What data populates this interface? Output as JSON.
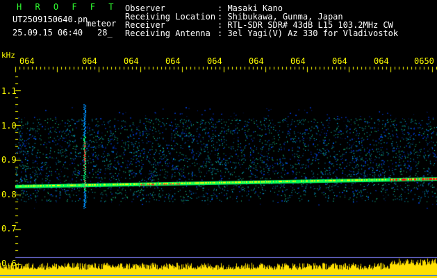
{
  "header": {
    "title": "H R O F F T",
    "filename": "UT2509150640.pn",
    "tag": "meteor",
    "datetime": "25.09.15 06:40",
    "count": "28_",
    "fields": [
      {
        "label": "Observer",
        "value": ": Masaki Kano"
      },
      {
        "label": "Receiving Location",
        "value": ": Shibukawa, Gunma, Japan"
      },
      {
        "label": "Receiver",
        "value": ": RTL-SDR SDR# 43dB L15 103.2MHz CW"
      },
      {
        "label": "Receiving Antenna",
        "value": ": 3el Yagi(V) Az 330 for Vladivostok"
      }
    ]
  },
  "axes": {
    "unit": "kHz",
    "time_ticks": [
      "064",
      "064",
      "064",
      "064",
      "064",
      "064",
      "064",
      "064",
      "064",
      "0650"
    ],
    "freq_ticks": [
      "1.1",
      "1.0",
      "0.9",
      "0.8",
      "0.7",
      "0.6"
    ]
  },
  "colors": {
    "text": "#ffffff",
    "title": "#30ff30",
    "ticks": "#ffff00",
    "background": "#000000"
  }
}
